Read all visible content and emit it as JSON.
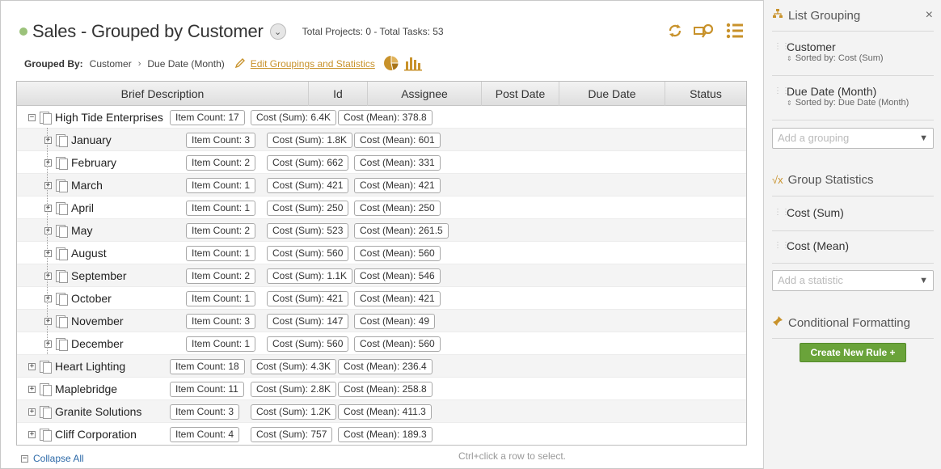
{
  "header": {
    "title": "Sales - Grouped by Customer",
    "summary": "Total Projects: 0 - Total Tasks: 53",
    "grouped_by_label": "Grouped By:",
    "groupings": [
      "Customer",
      "Due Date (Month)"
    ],
    "edit_link": "Edit Groupings and Statistics"
  },
  "columns": [
    "Brief Description",
    "Id",
    "Assignee",
    "Post Date",
    "Due Date",
    "Status"
  ],
  "rows": [
    {
      "level": 0,
      "toggle": "−",
      "name": "High Tide Enterprises",
      "count": "Item Count: 17",
      "sum": "Cost (Sum): 6.4K",
      "mean": "Cost (Mean): 378.8"
    },
    {
      "level": 1,
      "toggle": "+",
      "name": "January",
      "count": "Item Count: 3",
      "sum": "Cost (Sum): 1.8K",
      "mean": "Cost (Mean): 601"
    },
    {
      "level": 1,
      "toggle": "+",
      "name": "February",
      "count": "Item Count: 2",
      "sum": "Cost (Sum): 662",
      "mean": "Cost (Mean): 331"
    },
    {
      "level": 1,
      "toggle": "+",
      "name": "March",
      "count": "Item Count: 1",
      "sum": "Cost (Sum): 421",
      "mean": "Cost (Mean): 421"
    },
    {
      "level": 1,
      "toggle": "+",
      "name": "April",
      "count": "Item Count: 1",
      "sum": "Cost (Sum): 250",
      "mean": "Cost (Mean): 250"
    },
    {
      "level": 1,
      "toggle": "+",
      "name": "May",
      "count": "Item Count: 2",
      "sum": "Cost (Sum): 523",
      "mean": "Cost (Mean): 261.5"
    },
    {
      "level": 1,
      "toggle": "+",
      "name": "August",
      "count": "Item Count: 1",
      "sum": "Cost (Sum): 560",
      "mean": "Cost (Mean): 560"
    },
    {
      "level": 1,
      "toggle": "+",
      "name": "September",
      "count": "Item Count: 2",
      "sum": "Cost (Sum): 1.1K",
      "mean": "Cost (Mean): 546"
    },
    {
      "level": 1,
      "toggle": "+",
      "name": "October",
      "count": "Item Count: 1",
      "sum": "Cost (Sum): 421",
      "mean": "Cost (Mean): 421"
    },
    {
      "level": 1,
      "toggle": "+",
      "name": "November",
      "count": "Item Count: 3",
      "sum": "Cost (Sum): 147",
      "mean": "Cost (Mean): 49"
    },
    {
      "level": 1,
      "toggle": "+",
      "name": "December",
      "count": "Item Count: 1",
      "sum": "Cost (Sum): 560",
      "mean": "Cost (Mean): 560"
    },
    {
      "level": 0,
      "toggle": "+",
      "name": "Heart Lighting",
      "count": "Item Count: 18",
      "sum": "Cost (Sum): 4.3K",
      "mean": "Cost (Mean): 236.4"
    },
    {
      "level": 0,
      "toggle": "+",
      "name": "Maplebridge",
      "count": "Item Count: 11",
      "sum": "Cost (Sum): 2.8K",
      "mean": "Cost (Mean): 258.8"
    },
    {
      "level": 0,
      "toggle": "+",
      "name": "Granite Solutions",
      "count": "Item Count: 3",
      "sum": "Cost (Sum): 1.2K",
      "mean": "Cost (Mean): 411.3"
    },
    {
      "level": 0,
      "toggle": "+",
      "name": "Cliff Corporation",
      "count": "Item Count: 4",
      "sum": "Cost (Sum): 757",
      "mean": "Cost (Mean): 189.3"
    }
  ],
  "footer": {
    "collapse_all": "Collapse All",
    "hint": "Ctrl+click a row to select."
  },
  "sidebar": {
    "list_grouping_title": "List Grouping",
    "close": "×",
    "groupings": [
      {
        "name": "Customer",
        "sorted": "Sorted by: Cost (Sum)"
      },
      {
        "name": "Due Date (Month)",
        "sorted": "Sorted by: Due Date (Month)"
      }
    ],
    "add_grouping_placeholder": "Add a grouping",
    "group_statistics_title": "Group Statistics",
    "statistics": [
      "Cost (Sum)",
      "Cost (Mean)"
    ],
    "add_statistic_placeholder": "Add a statistic",
    "conditional_formatting_title": "Conditional Formatting",
    "create_rule_label": "Create New Rule +"
  },
  "colors": {
    "accent": "#c8922b",
    "status_dot": "#9bc27a",
    "button_green": "#6aa33a",
    "link_blue": "#2d6aa8"
  },
  "icons": [
    "refresh-icon",
    "find-icon",
    "list-icon",
    "pie-chart-icon",
    "bar-chart-icon",
    "pencil-icon",
    "hierarchy-icon",
    "sqrt-x-icon",
    "pin-icon"
  ]
}
